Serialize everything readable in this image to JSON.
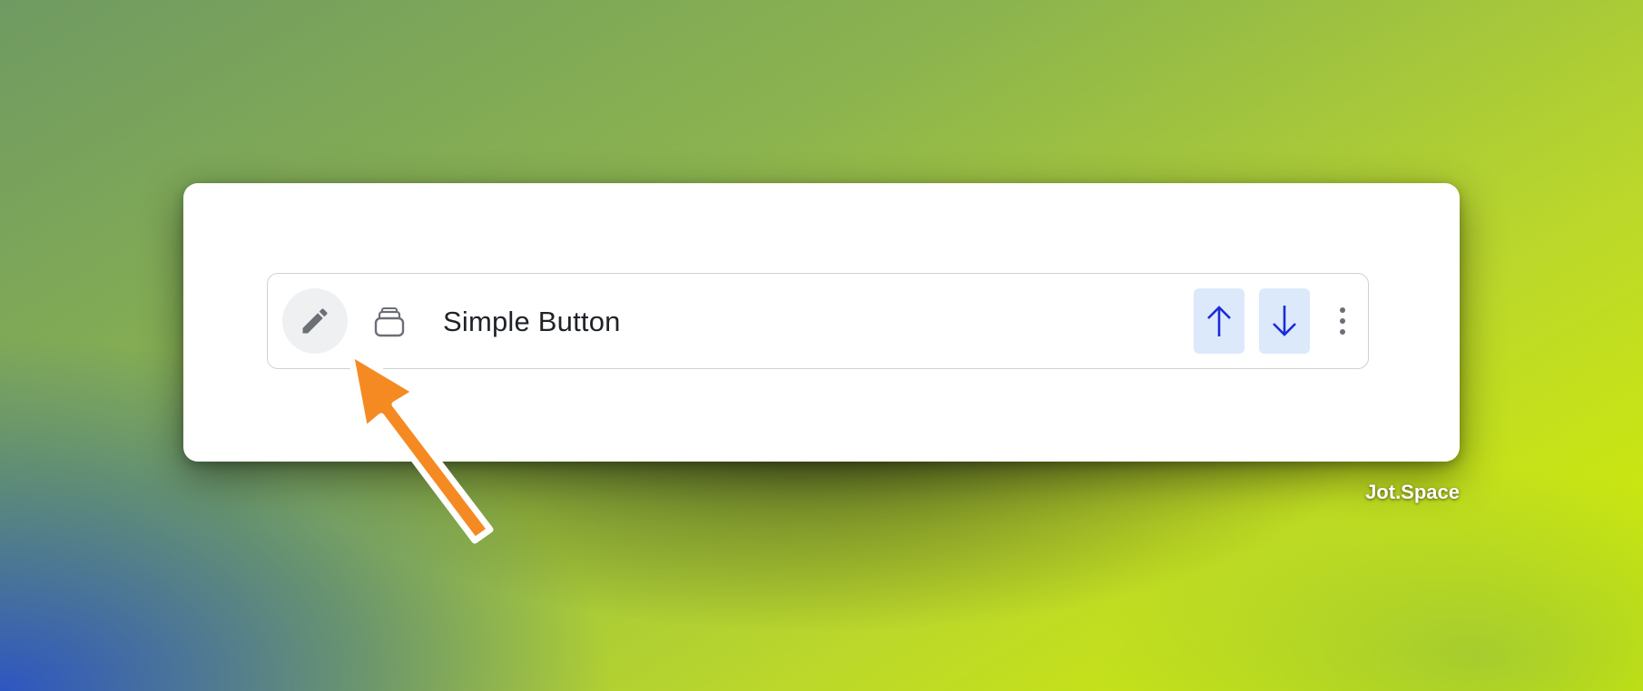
{
  "item": {
    "label": "Simple Button",
    "edit_icon": "pencil-icon",
    "type_icon": "stacked-box-icon"
  },
  "actions": {
    "move_up_icon": "arrow-up-icon",
    "move_down_icon": "arrow-down-icon",
    "more_icon": "vertical-ellipsis-icon"
  },
  "branding": {
    "watermark": "Jot.Space"
  },
  "annotation": {
    "pointer": "orange-arrow-icon"
  },
  "colors": {
    "accent_blue": "#1a2bd8",
    "button_bg": "#dce9fb",
    "icon_gray": "#6b6f76",
    "annotation_orange": "#f58a23"
  }
}
